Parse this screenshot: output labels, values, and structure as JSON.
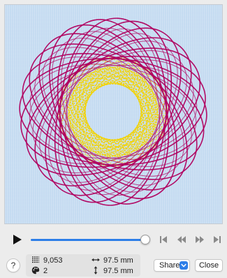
{
  "preview": {
    "background_color": "#c9dff4",
    "thread_colors": [
      "#b0005e",
      "#f2d300"
    ],
    "icons": [
      "embroidery-design-icon"
    ]
  },
  "playback": {
    "progress": 1.0,
    "accent_color": "#2d7ee8",
    "icons": [
      "play-icon",
      "jump-to-start-icon",
      "step-back-icon",
      "step-forward-icon",
      "jump-to-end-icon"
    ]
  },
  "stats": {
    "stitch_count": "9,053",
    "color_count": "2",
    "width": "97.5 mm",
    "height": "97.5 mm",
    "icons": [
      "stitch-count-icon",
      "palette-icon",
      "width-arrows-icon",
      "height-arrows-icon"
    ]
  },
  "footer": {
    "help_label": "?",
    "share_label": "Share",
    "close_label": "Close"
  }
}
